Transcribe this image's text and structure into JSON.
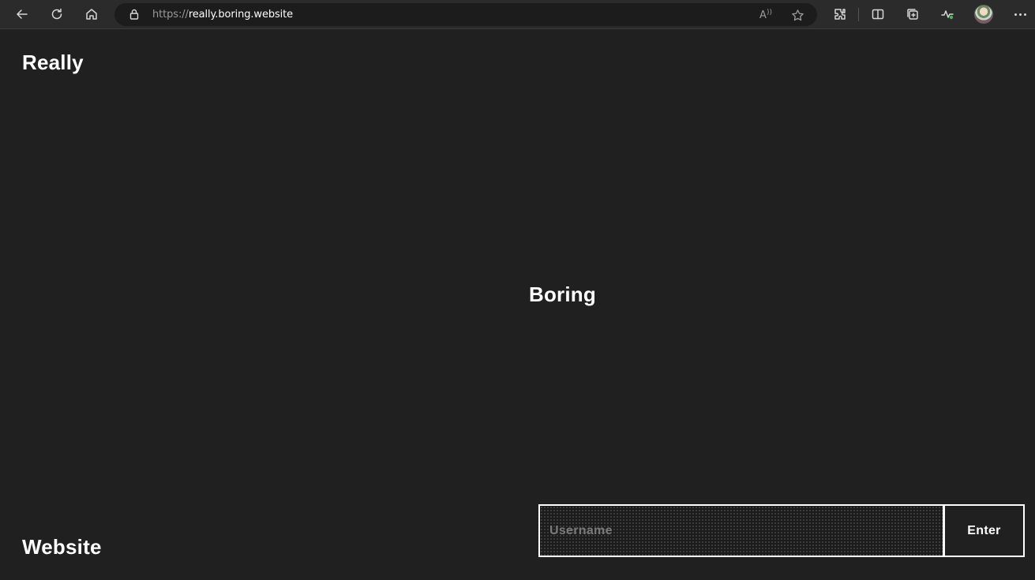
{
  "browser": {
    "url_scheme": "https://",
    "url_host": "really.boring.website",
    "icons": [
      "back-arrow-icon",
      "refresh-icon",
      "home-icon",
      "lock-icon",
      "read-aloud-icon",
      "favorite-star-icon",
      "extensions-icon",
      "split-screen-icon",
      "collections-icon",
      "browser-essentials-icon",
      "profile-avatar",
      "more-options-icon"
    ]
  },
  "page": {
    "word_top": "Really",
    "word_middle": "Boring",
    "word_bottom": "Website",
    "login": {
      "username_placeholder": "Username",
      "username_value": "",
      "enter_label": "Enter"
    }
  },
  "colors": {
    "background": "#202020",
    "text": "#ffffff",
    "toolbar": "#2b2b2b",
    "address_bar": "#1c1c1c"
  }
}
